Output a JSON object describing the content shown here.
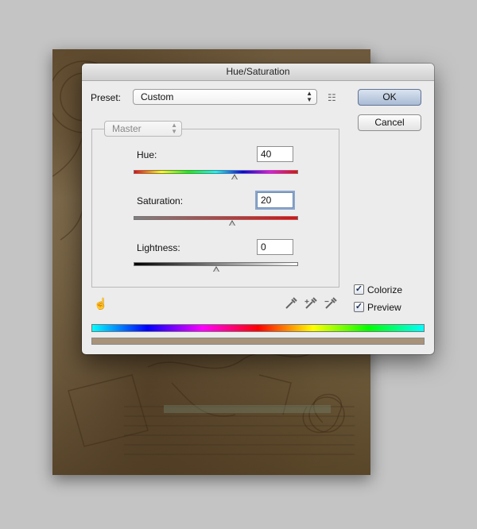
{
  "dialog": {
    "title": "Hue/Saturation",
    "preset_label": "Preset:",
    "preset_value": "Custom",
    "ok_label": "OK",
    "cancel_label": "Cancel",
    "channel_value": "Master",
    "hue": {
      "label": "Hue:",
      "value": "40",
      "min": -180,
      "max": 180
    },
    "saturation": {
      "label": "Saturation:",
      "value": "20",
      "min": -100,
      "max": 100
    },
    "lightness": {
      "label": "Lightness:",
      "value": "0",
      "min": -100,
      "max": 100
    },
    "colorize": {
      "label": "Colorize",
      "checked": true
    },
    "preview": {
      "label": "Preview",
      "checked": true
    },
    "icons": {
      "preset_options": "list-options-icon",
      "targeted_adjust": "hand-adjust-icon",
      "eyedropper": "eyedropper-icon",
      "eyedropper_add": "eyedropper-plus-icon",
      "eyedropper_subtract": "eyedropper-minus-icon"
    },
    "result_color": "#a8937a"
  }
}
